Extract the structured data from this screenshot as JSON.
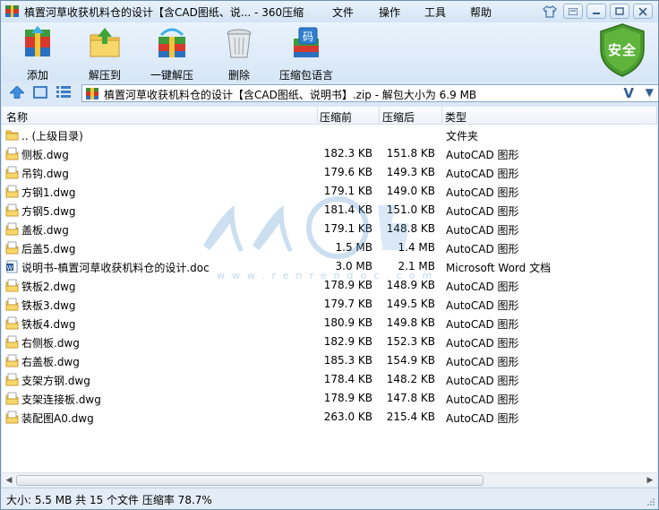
{
  "window": {
    "title": "槙置河草收获机料仓的设计【含CAD图纸、说... - 360压缩",
    "menu": [
      "文件",
      "操作",
      "工具",
      "帮助"
    ]
  },
  "toolbar": {
    "add_label": "添加",
    "extract_label": "解压到",
    "one_click_label": "一键解压",
    "delete_label": "删除",
    "encoding_label": "压缩包语言",
    "security_label": "安全"
  },
  "address": {
    "path": "槙置河草收获机料仓的设计【含CAD图纸、说明书】.zip - 解包大小为 6.9 MB",
    "v_label": "V"
  },
  "columns": {
    "name": "名称",
    "size": "压缩前",
    "packed": "压缩后",
    "type": "类型"
  },
  "files": [
    {
      "name": ".. (上级目录)",
      "size": "",
      "packed": "",
      "type": "文件夹",
      "icon": "folder-icon"
    },
    {
      "name": "侧板.dwg",
      "size": "182.3 KB",
      "packed": "151.8 KB",
      "type": "AutoCAD 图形",
      "icon": "dwg-icon"
    },
    {
      "name": "吊钩.dwg",
      "size": "179.6 KB",
      "packed": "149.3 KB",
      "type": "AutoCAD 图形",
      "icon": "dwg-icon"
    },
    {
      "name": "方钢1.dwg",
      "size": "179.1 KB",
      "packed": "149.0 KB",
      "type": "AutoCAD 图形",
      "icon": "dwg-icon"
    },
    {
      "name": "方钢5.dwg",
      "size": "181.4 KB",
      "packed": "151.0 KB",
      "type": "AutoCAD 图形",
      "icon": "dwg-icon"
    },
    {
      "name": "盖板.dwg",
      "size": "179.1 KB",
      "packed": "148.8 KB",
      "type": "AutoCAD 图形",
      "icon": "dwg-icon"
    },
    {
      "name": "后盖5.dwg",
      "size": "1.5 MB",
      "packed": "1.4 MB",
      "type": "AutoCAD 图形",
      "icon": "dwg-icon"
    },
    {
      "name": "说明书-槙置河草收获机料仓的设计.doc",
      "size": "3.0 MB",
      "packed": "2.1 MB",
      "type": "Microsoft Word 文档",
      "icon": "word-icon"
    },
    {
      "name": "铁板2.dwg",
      "size": "178.9 KB",
      "packed": "148.9 KB",
      "type": "AutoCAD 图形",
      "icon": "dwg-icon"
    },
    {
      "name": "铁板3.dwg",
      "size": "179.7 KB",
      "packed": "149.5 KB",
      "type": "AutoCAD 图形",
      "icon": "dwg-icon"
    },
    {
      "name": "铁板4.dwg",
      "size": "180.9 KB",
      "packed": "149.8 KB",
      "type": "AutoCAD 图形",
      "icon": "dwg-icon"
    },
    {
      "name": "右侧板.dwg",
      "size": "182.9 KB",
      "packed": "152.3 KB",
      "type": "AutoCAD 图形",
      "icon": "dwg-icon"
    },
    {
      "name": "右盖板.dwg",
      "size": "185.3 KB",
      "packed": "154.9 KB",
      "type": "AutoCAD 图形",
      "icon": "dwg-icon"
    },
    {
      "name": "支架方钢.dwg",
      "size": "178.4 KB",
      "packed": "148.2 KB",
      "type": "AutoCAD 图形",
      "icon": "dwg-icon"
    },
    {
      "name": "支架连接板.dwg",
      "size": "178.9 KB",
      "packed": "147.8 KB",
      "type": "AutoCAD 图形",
      "icon": "dwg-icon"
    },
    {
      "name": "装配图A0.dwg",
      "size": "263.0 KB",
      "packed": "215.4 KB",
      "type": "AutoCAD 图形",
      "icon": "dwg-icon"
    }
  ],
  "status": {
    "text": "大小: 5.5 MB 共 15 个文件 压缩率 78.7%"
  },
  "colors": {
    "accent": "#3d7cc9",
    "shield": "#4a9a2f",
    "window_bg": "#dbe8f6"
  }
}
